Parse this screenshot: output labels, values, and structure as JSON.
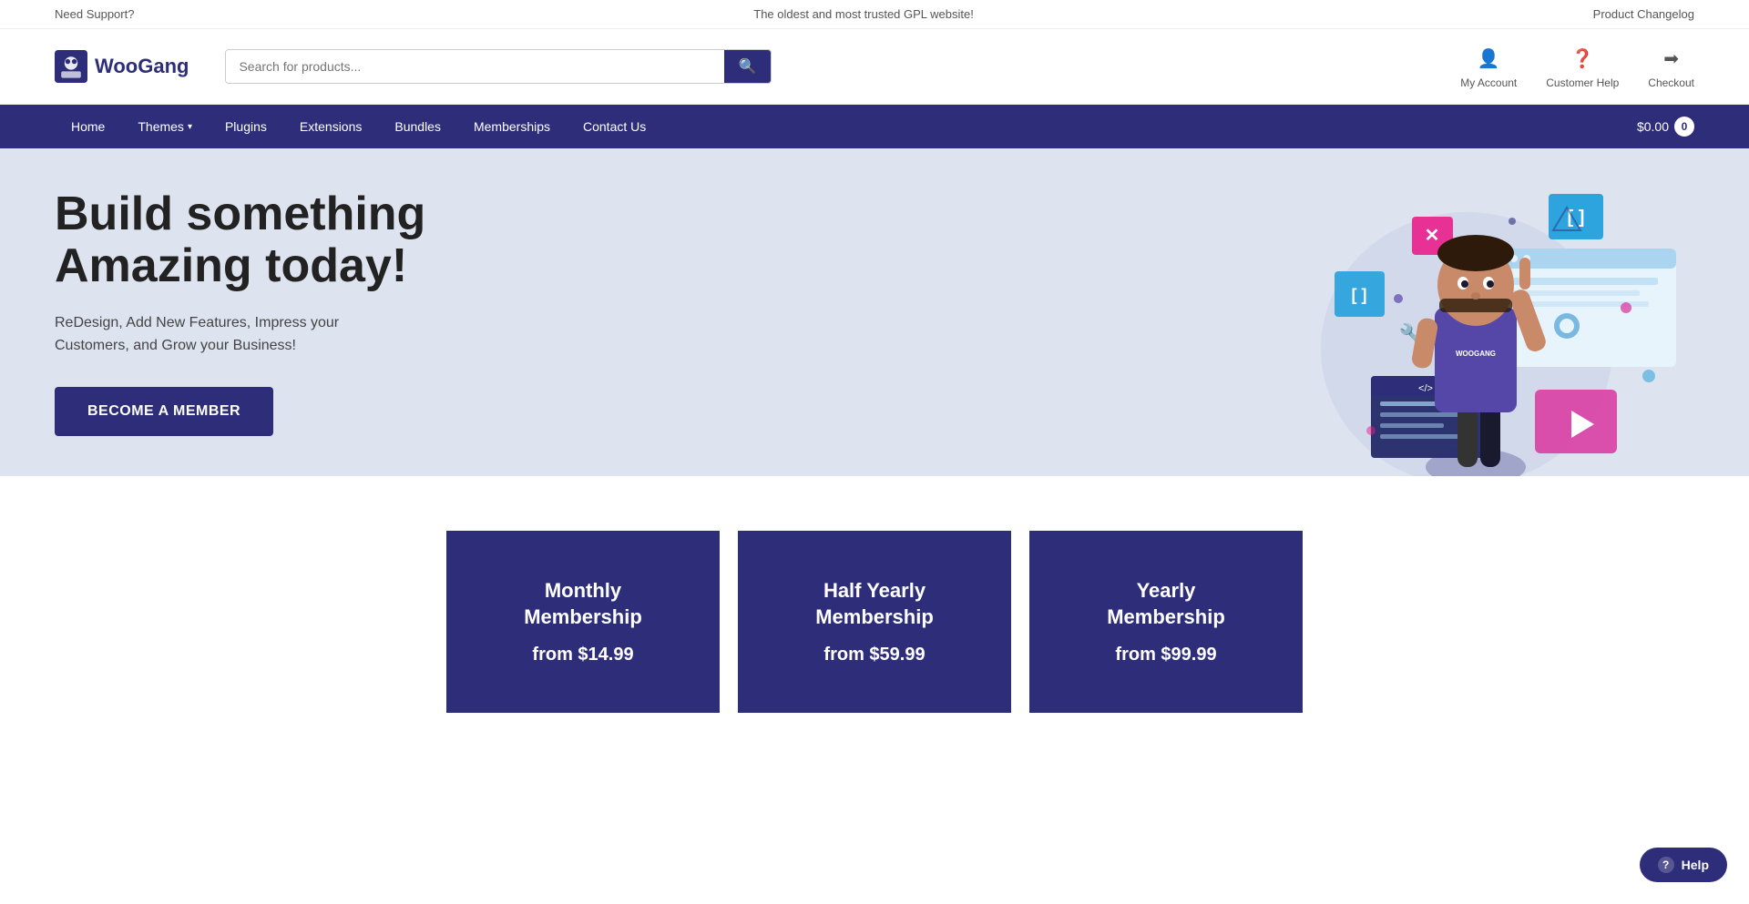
{
  "topbar": {
    "left": "Need Support?",
    "center": "The oldest and most trusted GPL website!",
    "right": "Product Changelog"
  },
  "header": {
    "logo_text": "WooGang",
    "search_placeholder": "Search for products...",
    "icons": [
      {
        "id": "my-account",
        "label": "My Account",
        "icon": "👤"
      },
      {
        "id": "customer-help",
        "label": "Customer Help",
        "icon": "❓"
      },
      {
        "id": "checkout",
        "label": "Checkout",
        "icon": "➡"
      }
    ]
  },
  "nav": {
    "links": [
      {
        "id": "home",
        "label": "Home",
        "has_chevron": false
      },
      {
        "id": "themes",
        "label": "Themes",
        "has_chevron": true
      },
      {
        "id": "plugins",
        "label": "Plugins",
        "has_chevron": false
      },
      {
        "id": "extensions",
        "label": "Extensions",
        "has_chevron": false
      },
      {
        "id": "bundles",
        "label": "Bundles",
        "has_chevron": false
      },
      {
        "id": "memberships",
        "label": "Memberships",
        "has_chevron": false
      },
      {
        "id": "contact-us",
        "label": "Contact Us",
        "has_chevron": false
      }
    ],
    "cart_price": "$0.00",
    "cart_count": "0"
  },
  "hero": {
    "title_line1": "Build something",
    "title_line2": "Amazing today!",
    "subtitle": "ReDesign, Add New Features, Impress your\nCustomers, and Grow your Business!",
    "cta_label": "Become A Member"
  },
  "memberships": {
    "cards": [
      {
        "id": "monthly",
        "title": "Monthly Membership",
        "price_label": "from $14.99"
      },
      {
        "id": "half-yearly",
        "title": "Half Yearly Membership",
        "price_label": "from $59.99"
      },
      {
        "id": "yearly",
        "title": "Yearly Membership",
        "price_label": "from $99.99"
      }
    ]
  },
  "help_button": {
    "label": "Help"
  },
  "colors": {
    "brand": "#2d2d7a",
    "hero_bg": "#dde3ef",
    "white": "#ffffff"
  }
}
